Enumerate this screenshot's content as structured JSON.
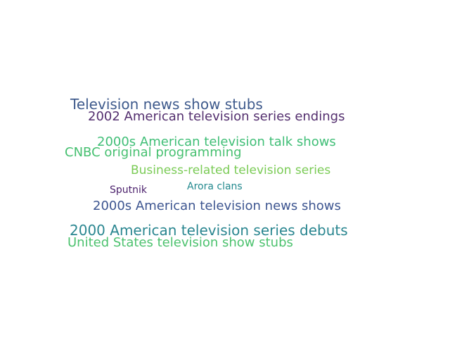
{
  "words": [
    {
      "text": "Television news show stubs",
      "color": "#3e5a8c"
    },
    {
      "text": "2002 American television series endings",
      "color": "#532e6e"
    },
    {
      "text": "2000s American television talk shows",
      "color": "#3fbe76"
    },
    {
      "text": "CNBC original programming",
      "color": "#46c070"
    },
    {
      "text": "Business-related television series",
      "color": "#7acb55"
    },
    {
      "text": "Arora clans",
      "color": "#23898e"
    },
    {
      "text": "Sputnik",
      "color": "#4a1f6b"
    },
    {
      "text": "2000s American television news shows",
      "color": "#3d5590"
    },
    {
      "text": "2000 American television series debuts",
      "color": "#2a8690"
    },
    {
      "text": "United States television show stubs",
      "color": "#4cc26e"
    }
  ]
}
